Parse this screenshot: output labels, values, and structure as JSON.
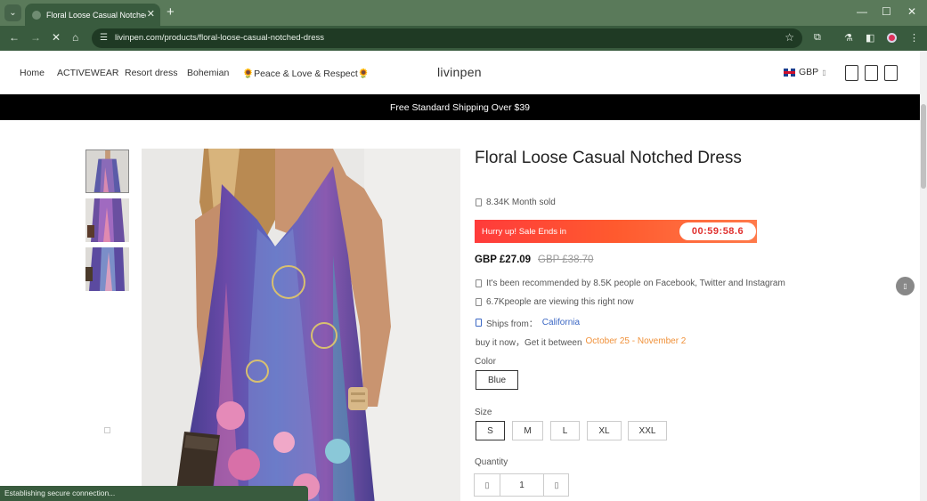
{
  "browser": {
    "tab_title": "Floral Loose Casual Notched D",
    "url": "livinpen.com/products/floral-loose-casual-notched-dress",
    "status_text": "Establishing secure connection..."
  },
  "nav": {
    "links": [
      "Home",
      "ACTIVEWEAR",
      "Resort dress",
      "Bohemian",
      "🌻Peace & Love & Respect🌻"
    ],
    "logo": "livinpen",
    "currency": "GBP"
  },
  "banner": "Free Standard Shipping Over $39",
  "product": {
    "title": "Floral Loose Casual Notched Dress",
    "month_sold": "8.34K Month sold",
    "sale_text": "Hurry up! Sale Ends in",
    "countdown": "00:59:58.6",
    "price": "GBP £27.09",
    "old_price": "GBP £38.70",
    "recommended": "It's been recommended by 8.5K people on Facebook, Twitter and Instagram",
    "viewing": "6.7Kpeople are viewing this right now",
    "ships_label": "Ships from：",
    "ships_from": "California",
    "delivery_prefix": "buy it now，Get it between",
    "delivery_start": "October 25",
    "delivery_sep": " - ",
    "delivery_end": "November 2",
    "color_label": "Color",
    "color_option": "Blue",
    "size_label": "Size",
    "sizes": [
      "S",
      "M",
      "L",
      "XL",
      "XXL"
    ],
    "quantity_label": "Quantity",
    "quantity": "1"
  },
  "colors": {
    "tab_bar": "#5a7a5a",
    "toolbar": "#395b3e",
    "banner": "#000000",
    "sale_gradient_start": "#ff3b3b",
    "countdown_text": "#e0302e",
    "link": "#3b67c4",
    "delivery_date": "#f0913a"
  }
}
